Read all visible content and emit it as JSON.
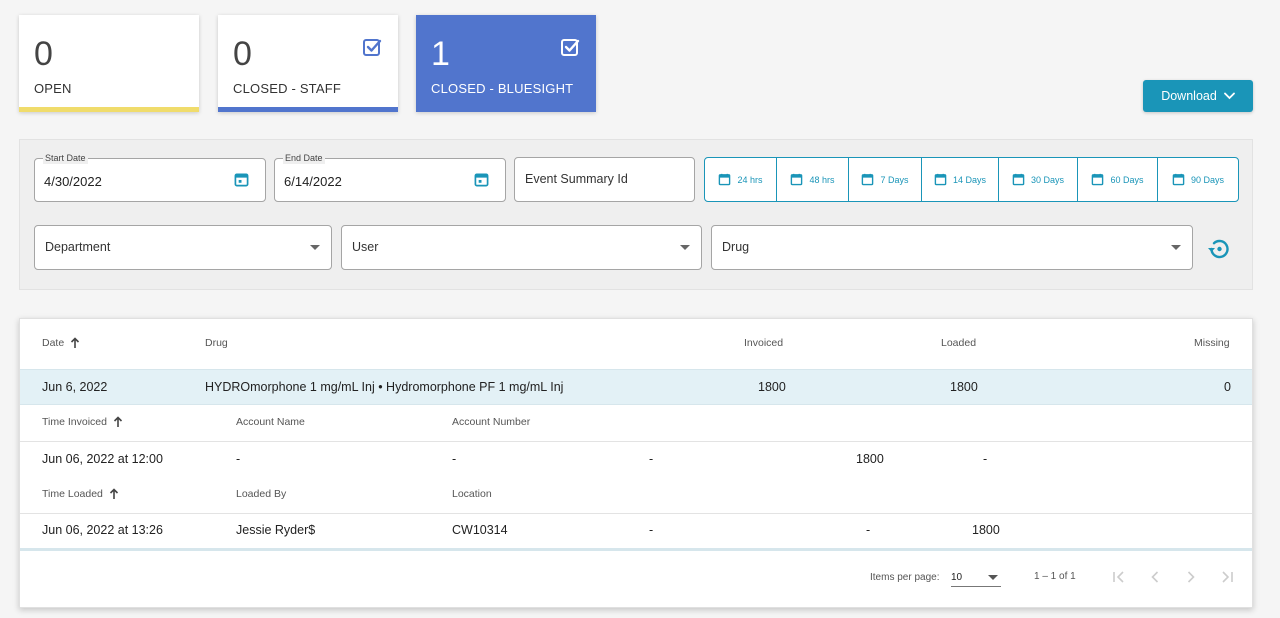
{
  "cards": [
    {
      "count": "0",
      "label": "OPEN",
      "bar_color": "#f0dc6b",
      "checked": false,
      "active": false
    },
    {
      "count": "0",
      "label": "CLOSED - STAFF",
      "bar_color": "#5175cd",
      "checked": true,
      "active": false
    },
    {
      "count": "1",
      "label": "CLOSED - BLUESIGHT",
      "bar_color": "#5175cd",
      "checked": true,
      "active": true
    }
  ],
  "download": {
    "label": "Download",
    "icon": "chevron-down-icon"
  },
  "filters": {
    "start_date": {
      "label": "Start Date",
      "value": "4/30/2022",
      "icon": "calendar-icon"
    },
    "end_date": {
      "label": "End Date",
      "value": "6/14/2022",
      "icon": "calendar-icon"
    },
    "event_summary_placeholder": "Event Summary Id",
    "ranges": [
      "24 hrs",
      "48 hrs",
      "7 Days",
      "14 Days",
      "30 Days",
      "60 Days",
      "90 Days"
    ],
    "department_placeholder": "Department",
    "user_placeholder": "User",
    "drug_placeholder": "Drug",
    "reset_icon": "restore-icon"
  },
  "table": {
    "headers": {
      "date": "Date",
      "drug": "Drug",
      "invoiced": "Invoiced",
      "loaded": "Loaded",
      "missing": "Missing"
    },
    "row": {
      "date": "Jun 6, 2022",
      "drug": "HYDROmorphone 1 mg/mL Inj • Hydromorphone PF 1 mg/mL Inj",
      "invoiced": "1800",
      "loaded": "1800",
      "missing": "0"
    },
    "invoiced_section": {
      "headers": {
        "time": "Time Invoiced",
        "account_name": "Account Name",
        "account_number": "Account Number"
      },
      "row": {
        "time": "Jun 06, 2022 at 12:00",
        "account_name": "-",
        "account_number": "-",
        "col4": "-",
        "col5": "1800",
        "col6": "-"
      }
    },
    "loaded_section": {
      "headers": {
        "time": "Time Loaded",
        "loaded_by": "Loaded By",
        "location": "Location"
      },
      "row": {
        "time": "Jun 06, 2022 at 13:26",
        "loaded_by": "Jessie Ryder$",
        "location": "CW10314",
        "col4": "-",
        "col5": "-",
        "col6": "1800"
      }
    }
  },
  "pagination": {
    "items_per_page_label": "Items per page:",
    "items_per_page": "10",
    "range": "1 – 1 of 1"
  },
  "colors": {
    "accent": "#1a95b8",
    "active_card": "#5175cd",
    "open_bar": "#f0dc6b",
    "row_highlight": "#e3f1f6"
  }
}
